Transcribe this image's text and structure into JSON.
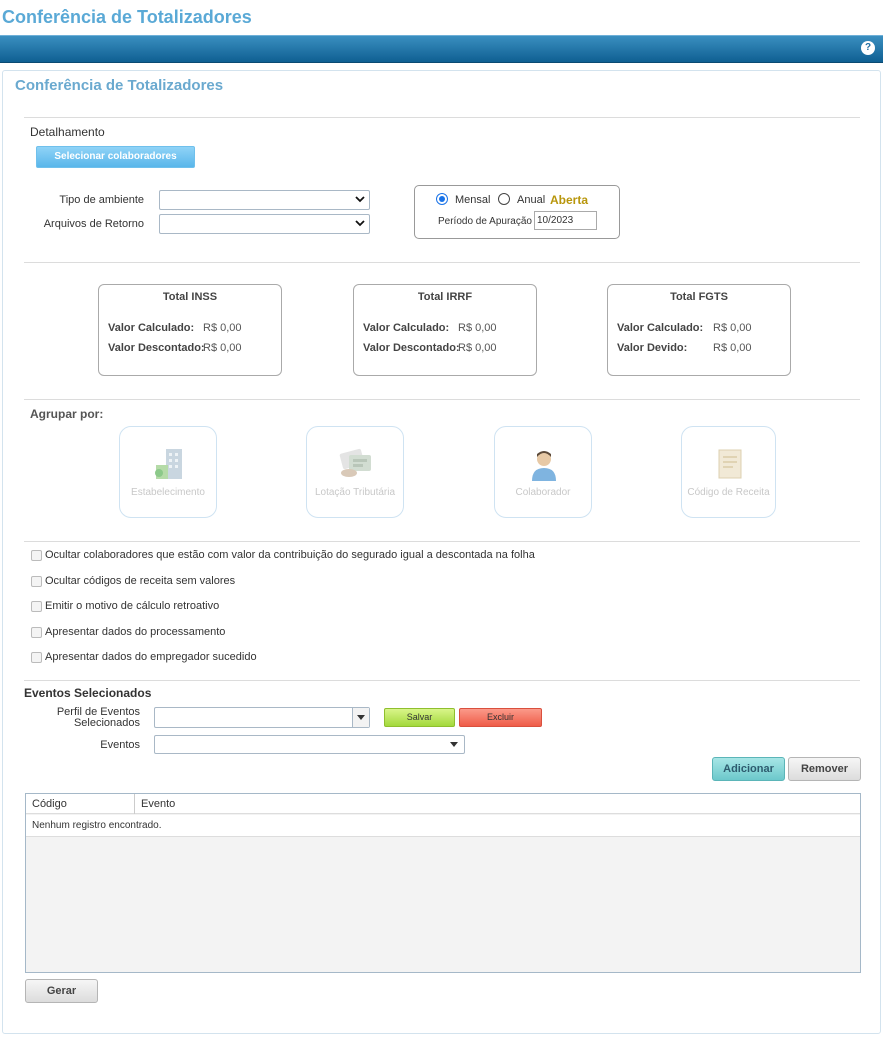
{
  "header": {
    "title": "Conferência de Totalizadores",
    "help_icon": "?"
  },
  "panel": {
    "title": "Conferência de Totalizadores"
  },
  "detalhamento": {
    "label": "Detalhamento",
    "select_button": "Selecionar colaboradores",
    "tipo_ambiente_label": "Tipo de ambiente",
    "tipo_ambiente_value": "",
    "arquivos_retorno_label": "Arquivos de Retorno",
    "arquivos_retorno_value": ""
  },
  "periodo": {
    "mensal_label": "Mensal",
    "anual_label": "Anual",
    "mensal_selected": true,
    "status": "Aberta",
    "status_color": "#b8960c",
    "apuracao_label": "Período de Apuração",
    "apuracao_value": "10/2023"
  },
  "totals": [
    {
      "title": "Total INSS",
      "rows": [
        {
          "label": "Valor Calculado:",
          "value": "R$ 0,00"
        },
        {
          "label": "Valor Descontado:",
          "value": "R$ 0,00"
        }
      ]
    },
    {
      "title": "Total IRRF",
      "rows": [
        {
          "label": "Valor Calculado:",
          "value": "R$ 0,00"
        },
        {
          "label": "Valor Descontado:",
          "value": "R$ 0,00"
        }
      ]
    },
    {
      "title": "Total FGTS",
      "rows": [
        {
          "label": "Valor Calculado:",
          "value": "R$ 0,00"
        },
        {
          "label": "Valor Devido:",
          "value": "R$ 0,00"
        }
      ]
    }
  ],
  "agrupar": {
    "label": "Agrupar por:",
    "options": [
      {
        "label": "Estabelecimento",
        "icon": "building-icon"
      },
      {
        "label": "Lotação Tributária",
        "icon": "lotacao-icon"
      },
      {
        "label": "Colaborador",
        "icon": "person-icon"
      },
      {
        "label": "Código de Receita",
        "icon": "document-icon"
      }
    ]
  },
  "options": [
    "Ocultar colaboradores que estão com valor da contribuição do segurado igual a descontada na folha",
    "Ocultar códigos de receita sem valores",
    "Emitir o motivo de cálculo retroativo",
    "Apresentar dados do processamento",
    "Apresentar dados do empregador sucedido"
  ],
  "eventos": {
    "title": "Eventos Selecionados",
    "perfil_label_1": "Perfil de Eventos",
    "perfil_label_2": "Selecionados",
    "perfil_value": "",
    "salvar": "Salvar",
    "excluir": "Excluir",
    "eventos_label": "Eventos",
    "eventos_value": "",
    "adicionar": "Adicionar",
    "remover": "Remover"
  },
  "table": {
    "columns": [
      "Código",
      "Evento"
    ],
    "empty_message": "Nenhum registro encontrado."
  },
  "footer": {
    "gerar": "Gerar"
  },
  "colors": {
    "accent": "#5aa9d6",
    "bar": "#1f6ea3",
    "salvar": "#a9e34b",
    "excluir": "#f26b5b",
    "adicionar": "#7fd3d6"
  }
}
